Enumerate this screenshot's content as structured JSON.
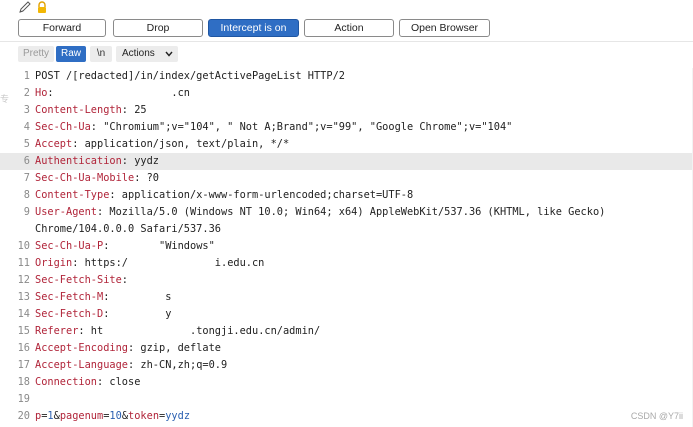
{
  "toolbar": {
    "pencil_icon": "pencil-icon",
    "lock_icon": "lock-icon",
    "buttons": [
      {
        "label": "Forward"
      },
      {
        "label": "Drop"
      },
      {
        "label": "Intercept is on"
      },
      {
        "label": "Action"
      },
      {
        "label": "Open Browser"
      }
    ]
  },
  "view_tabs": {
    "pretty": "Pretty",
    "raw": "Raw",
    "newline": "\\n",
    "actions": "Actions"
  },
  "editor": {
    "lines": [
      {
        "n": "1",
        "text": "POST /[redacted]/in/index/getActivePageList HTTP/2"
      },
      {
        "n": "2",
        "key": "Ho",
        "value": "                   .cn"
      },
      {
        "n": "3",
        "key": "Content-Length",
        "value": " 25"
      },
      {
        "n": "4",
        "key": "Sec-Ch-Ua",
        "value": " \"Chromium\";v=\"104\", \" Not A;Brand\";v=\"99\", \"Google Chrome\";v=\"104\""
      },
      {
        "n": "5",
        "key": "Accept",
        "value": " application/json, text/plain, */*"
      },
      {
        "n": "6",
        "key": "Authentication",
        "value": " yydz"
      },
      {
        "n": "7",
        "key": "Sec-Ch-Ua-Mobile",
        "value": " ?0"
      },
      {
        "n": "8",
        "key": "Content-Type",
        "value": " application/x-www-form-urlencoded;charset=UTF-8"
      },
      {
        "n": "9",
        "key": "User-Agent",
        "value": " Mozilla/5.0 (Windows NT 10.0; Win64; x64) AppleWebKit/537.36 (KHTML, like Gecko)"
      },
      {
        "n": "",
        "text": "Chrome/104.0.0.0 Safari/537.36"
      },
      {
        "n": "10",
        "key": "Sec-Ch-Ua-P",
        "value": "        \"Windows\""
      },
      {
        "n": "11",
        "key": "Origin",
        "value": " https:/              i.edu.cn"
      },
      {
        "n": "12",
        "key": "Sec-Fetch-Site",
        "value": ""
      },
      {
        "n": "13",
        "key": "Sec-Fetch-M",
        "value": "         s"
      },
      {
        "n": "14",
        "key": "Sec-Fetch-D",
        "value": "         y"
      },
      {
        "n": "15",
        "key": "Referer",
        "value": " ht              .tongji.edu.cn/admin/"
      },
      {
        "n": "16",
        "key": "Accept-Encoding",
        "value": " gzip, deflate"
      },
      {
        "n": "17",
        "key": "Accept-Language",
        "value": " zh-CN,zh;q=0.9"
      },
      {
        "n": "18",
        "key": "Connection",
        "value": " close"
      },
      {
        "n": "19",
        "text": ""
      },
      {
        "n": "20",
        "params": [
          {
            "k": "p",
            "v": "1"
          },
          {
            "k": "pagenum",
            "v": "10"
          },
          {
            "k": "token",
            "v": "yydz"
          }
        ]
      }
    ]
  },
  "left_fragment": "专",
  "watermark": "CSDN @Y7ii",
  "colors": {
    "accent": "#2f6ec4",
    "header_key": "#b1253a",
    "param_value": "#2a5fb0",
    "highlight_row": "#e9e9e9"
  }
}
